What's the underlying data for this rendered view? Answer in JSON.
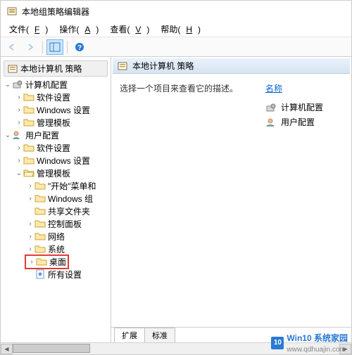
{
  "title": "本地组策略编辑器",
  "menus": {
    "file": "文件(F)",
    "action": "操作(A)",
    "view": "查看(V)",
    "help": "帮助(H)"
  },
  "toolbar": {
    "back": "back-icon",
    "forward": "forward-icon",
    "up": "up-icon",
    "showhide": "showhide-icon",
    "help": "help-icon"
  },
  "tree": {
    "root": "本地计算机 策略",
    "computer": "计算机配置",
    "user": "用户配置",
    "software": "软件设置",
    "windows": "Windows 设置",
    "admin": "管理模板",
    "start": "\"开始\"菜单和",
    "wincomp": "Windows 组",
    "shared": "共享文件夹",
    "control": "控制面板",
    "network": "网络",
    "system": "系统",
    "desktop": "桌面",
    "allsettings": "所有设置"
  },
  "detail": {
    "header": "本地计算机 策略",
    "desc": "选择一个项目来查看它的描述。",
    "col_name": "名称",
    "items": {
      "computer": "计算机配置",
      "user": "用户配置"
    }
  },
  "tabs": {
    "extended": "扩展",
    "standard": "标准"
  },
  "watermark": {
    "brand": "Win10",
    "tagline": "系统家园",
    "url": "www.qdhuajin.com"
  },
  "icons": {
    "policy": "policy-icon",
    "gear": "gear-icon",
    "folder": "folder-icon",
    "folder_open": "folder-open-icon",
    "page": "page-icon"
  }
}
